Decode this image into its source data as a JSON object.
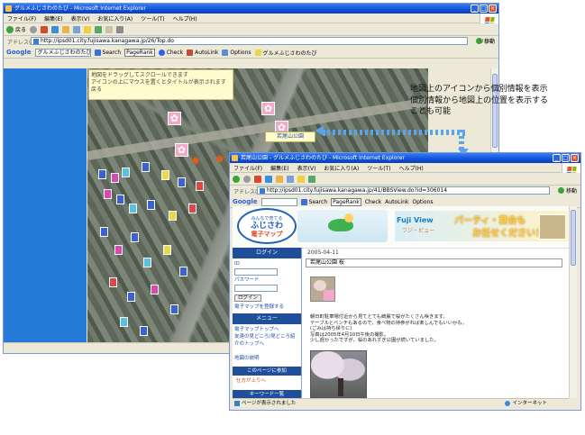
{
  "main_window": {
    "title": "グルメふじさわのたび - Microsoft Internet Explorer",
    "menu": [
      "ファイル(F)",
      "編集(E)",
      "表示(V)",
      "お気に入り(A)",
      "ツール(T)",
      "ヘルプ(H)"
    ],
    "toolbar": {
      "back_label": "戻る",
      "links_label": "リンク"
    },
    "address": {
      "label": "アドレス(D)",
      "url": "http://ipsd01.city.fujisawa.kanagawa.jp/26/Top.do",
      "go_label": "移動"
    },
    "google_bar": {
      "logo": "Google",
      "search_value": "グルメふじさわのたび",
      "search_label": "Search",
      "pagerank_label": "PageRank",
      "check_label": "Check",
      "autolink_label": "AutoLink",
      "options_label": "Options",
      "query_label": "グルメふじさわのたび"
    },
    "map_hint": [
      "地図をドラッグしてスクロールできます",
      "アイコンの上にマウスを置くとタイトルが表示されます",
      "戻る"
    ],
    "map_label": "若尾山公園"
  },
  "callout": {
    "line1": "地図上のアイコンから個別情報を表示",
    "line2": "個別情報から地図上の位置を表示する",
    "line3": "ことも可能"
  },
  "popup_window": {
    "title": "若尾山公園 - グルメふじさわのたび - Microsoft Internet Explorer",
    "menu": [
      "ファイル(F)",
      "編集(E)",
      "表示(V)",
      "お気に入り(A)",
      "ツール(T)",
      "ヘルプ(H)"
    ],
    "address": {
      "label": "アドレス(D)",
      "url": "http://ipsd01.city.fujisawa.kanagawa.jp/41/BBSView.do?id=306014",
      "go_label": "移動"
    },
    "google_bar": {
      "logo": "Google",
      "search_label": "Search",
      "pagerank_label": "PageRank",
      "check_label": "Check",
      "autolink_label": "AutoLink",
      "options_label": "Options"
    },
    "banner": {
      "logo_top": "みんなで育てる",
      "logo_main": "ふじさわ",
      "logo_sub": "電子マップ",
      "ad_brand": "Fuji View",
      "ad_brand_sub": "フジ・ビュー",
      "ad_text1": "パーティ・宴会も",
      "ad_text2": "お任せください！"
    },
    "sidebar": {
      "login_header": "ログイン",
      "id_label": "ID",
      "password_label": "パスワード",
      "login_button": "ログイン",
      "register_link": "電子マップを登録する",
      "menu_header": "メニュー",
      "menu_items": [
        "電子マップトップへ",
        "友達の見どころ/見どころ紹介のトップへ",
        "",
        "",
        "地図の説明"
      ],
      "join_header": "このページに参加",
      "join_link": "仕方が上りへ",
      "keyword_header": "キーワード一覧"
    },
    "content": {
      "date": "2005-04-11",
      "title": "若尾山公園 桜",
      "body": [
        "朝日町駐車場付近から見てとても綺麗で桜がたくさん咲きます。",
        "テーブルとベンチもあるので、食べ物の持参がれば楽しんでもいいかも。",
        "(ごみは持ち帰りに)",
        "写真は2005年4月10日午後の撮影。",
        "少し遅かったですが、桜のあれすぎ公園が続いていました。"
      ]
    },
    "status": {
      "done": "ページが表示されました",
      "zone": "インターネット"
    }
  }
}
